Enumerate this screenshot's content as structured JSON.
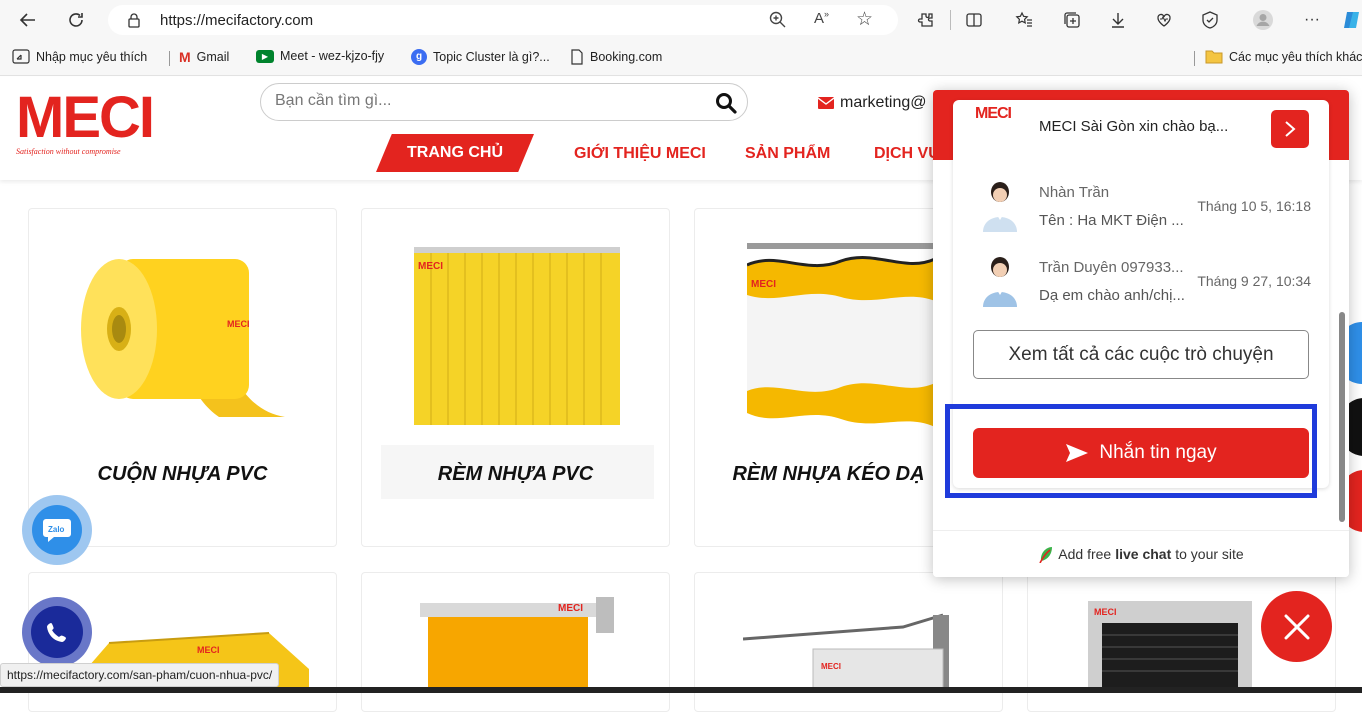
{
  "browser": {
    "url": "https://mecifactory.com",
    "bookmarks": [
      {
        "label": "Nhập mục yêu thích"
      },
      {
        "label": "Gmail"
      },
      {
        "label": "Meet - wez-kjzo-fjy"
      },
      {
        "label": "Topic Cluster là gì?..."
      },
      {
        "label": "Booking.com"
      }
    ],
    "other_favorites": "Các mục yêu thích khác",
    "status_url": "https://mecifactory.com/san-pham/cuon-nhua-pvc/"
  },
  "header": {
    "logo_text": "MECI",
    "logo_tagline": "Satisfaction without compromise",
    "search_placeholder": "Bạn cần tìm gì...",
    "email": "marketing@",
    "nav": [
      "TRANG CHỦ",
      "GIỚI THIỆU MECI",
      "SẢN PHẨM",
      "DỊCH VỤ"
    ]
  },
  "products": [
    {
      "title": "CUỘN NHỰA PVC"
    },
    {
      "title": "RÈM NHỰA PVC"
    },
    {
      "title": "RÈM NHỰA KÉO DẠ"
    }
  ],
  "chat": {
    "top_message": "MECI Sài Gòn xin chào bạ...",
    "conversations": [
      {
        "name": "Nhàn Trần",
        "message": "Tên : Ha MKT Điện ...",
        "time": "Tháng 10 5, 16:18"
      },
      {
        "name": "Trần Duyên 097933...",
        "message": "Dạ em chào anh/chị...",
        "time": "Tháng 9 27, 10:34"
      }
    ],
    "see_all_label": "Xem tất cả các cuộc trò chuyện",
    "send_label": "Nhắn tin ngay",
    "footer_prefix": "Add free",
    "footer_bold": "live chat",
    "footer_suffix": "to your site"
  },
  "colors": {
    "brand_red": "#e3241f",
    "highlight_blue": "#1f3bdb",
    "zalo_blue": "#2f8fe8",
    "phone_navy": "#1a2a9a"
  }
}
